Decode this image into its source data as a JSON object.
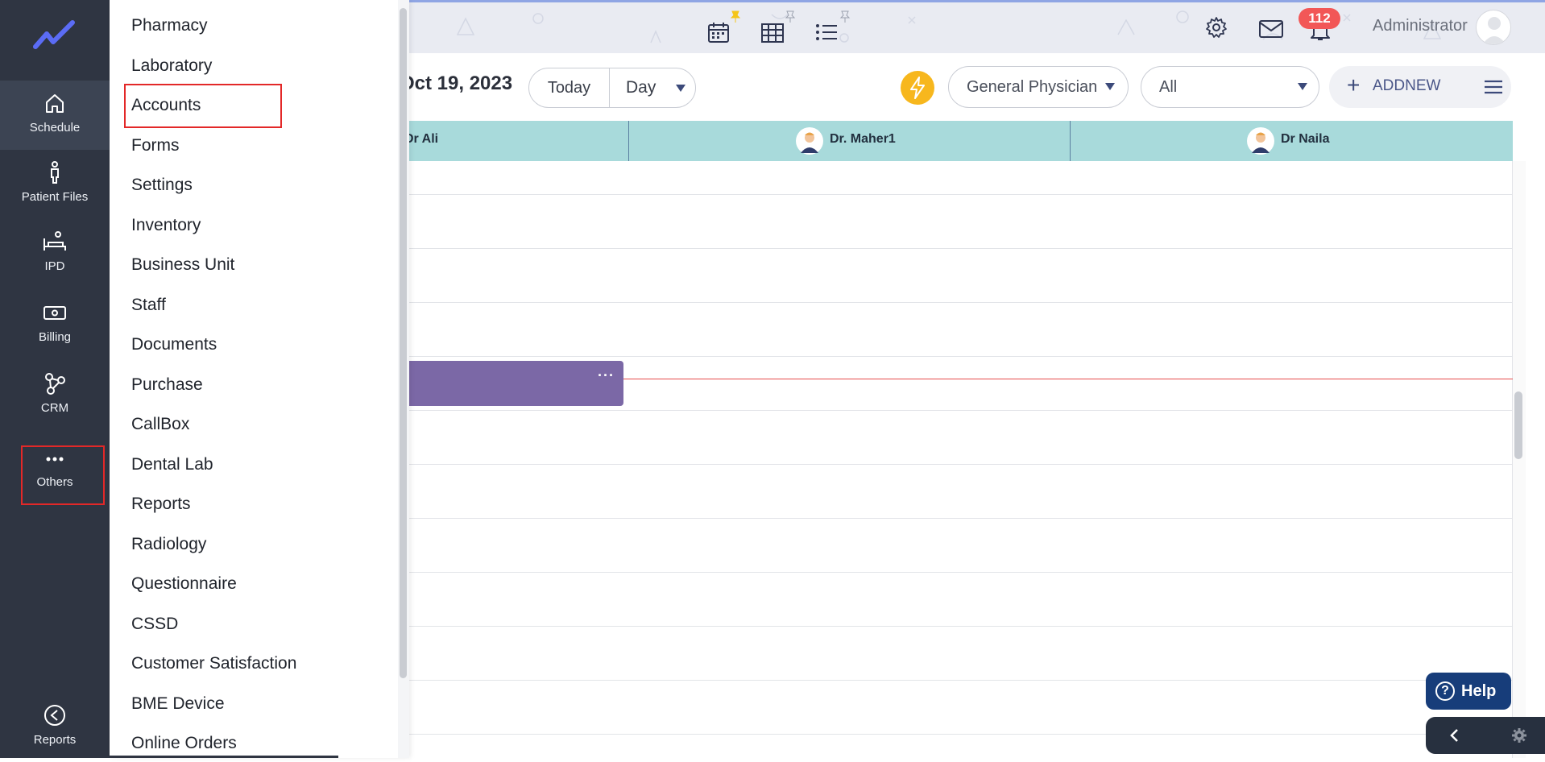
{
  "sidebar": {
    "items": [
      {
        "label": "Schedule",
        "icon": "home-icon"
      },
      {
        "label": "Patient Files",
        "icon": "patient-icon"
      },
      {
        "label": "IPD",
        "icon": "bed-icon"
      },
      {
        "label": "Billing",
        "icon": "cash-icon"
      },
      {
        "label": "CRM",
        "icon": "network-icon"
      },
      {
        "label": "Others",
        "icon": "more-dots-icon"
      },
      {
        "label": "Reports",
        "icon": "chevron-left-circle-icon"
      }
    ]
  },
  "others_menu": {
    "items": [
      "Pharmacy",
      "Laboratory",
      "Accounts",
      "Forms",
      "Settings",
      "Inventory",
      "Business Unit",
      "Staff",
      "Documents",
      "Purchase",
      "CallBox",
      "Dental Lab",
      "Reports",
      "Radiology",
      "Questionnaire",
      "CSSD",
      "Customer Satisfaction",
      "BME Device",
      "Online Orders"
    ],
    "highlighted": "Accounts"
  },
  "header": {
    "notification_count": "112",
    "user_name": "Administrator",
    "icons": [
      "calendar-icon",
      "table-grid-icon",
      "list-icon",
      "gear-icon",
      "mail-icon",
      "bell-icon"
    ]
  },
  "toolbar": {
    "date": "Oct 19, 2023",
    "today_label": "Today",
    "view_label": "Day",
    "physician_filter": "General Physician",
    "status_filter": "All",
    "add_new_label": "ADDNEW"
  },
  "doctors": [
    "Dr Ali",
    "Dr. Maher1",
    "Dr Naila"
  ],
  "appointment": {
    "more": "···"
  },
  "help": {
    "label": "Help"
  },
  "colors": {
    "sidebar": "#2f3542",
    "doctor_row": "#a8dadb",
    "appointment": "#7b68a6",
    "highlight": "#e32828",
    "badge": "#f25757",
    "help": "#173d7a"
  }
}
